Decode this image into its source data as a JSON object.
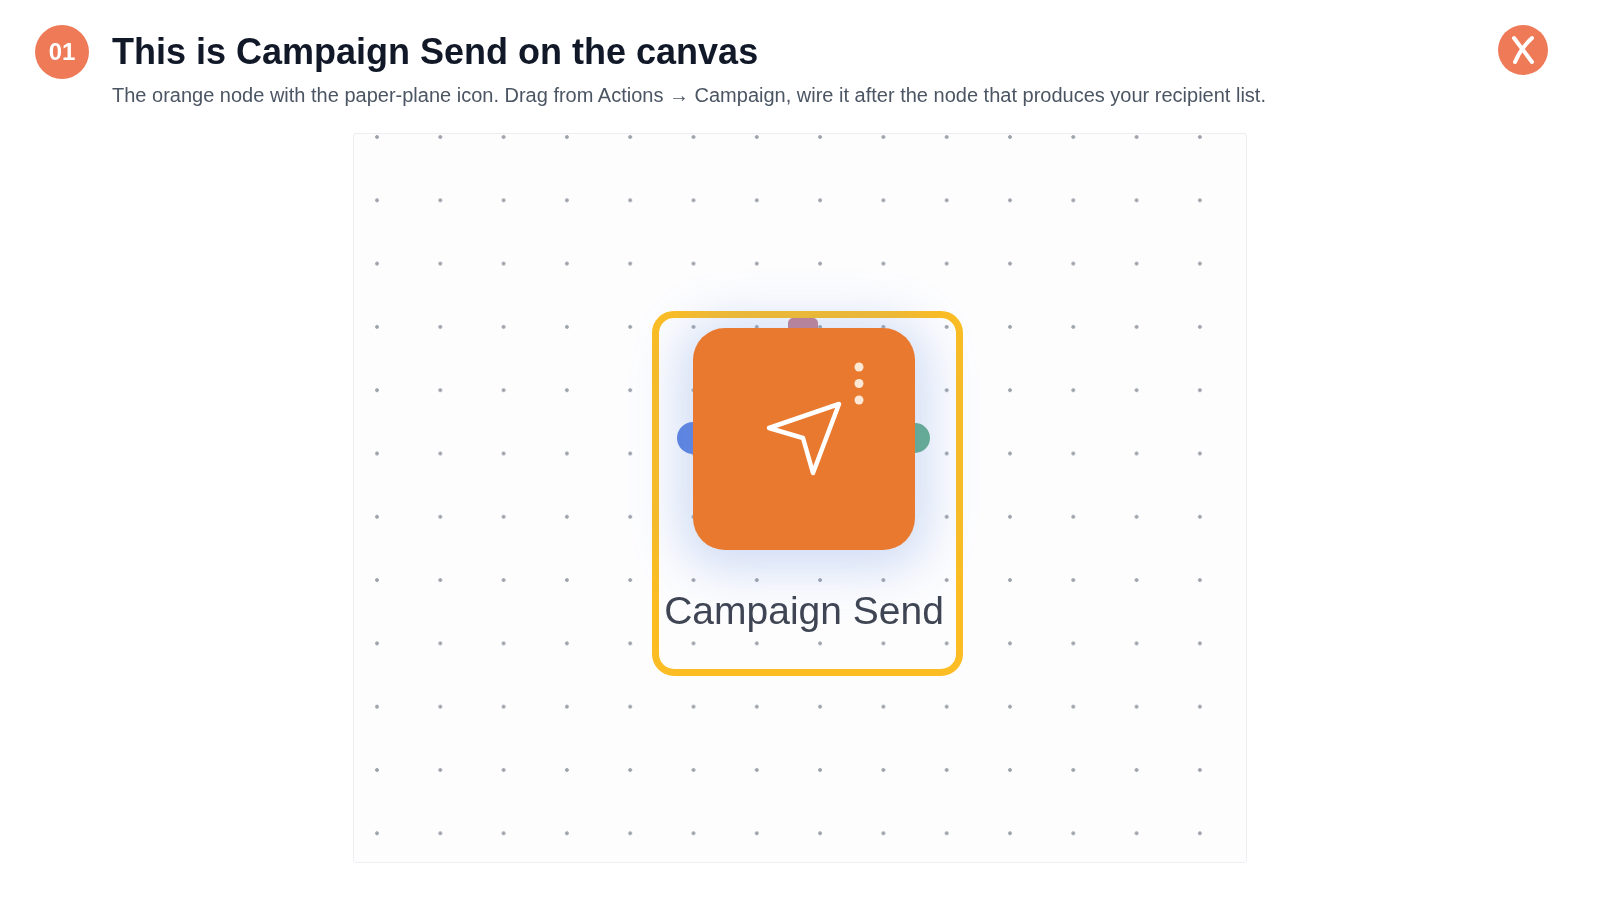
{
  "step": {
    "number": "01",
    "title": "This is Campaign Send on the canvas",
    "description": "The orange node with the paper-plane icon. Drag from Actions → Campaign, wire it after the node that produces your recipient list."
  },
  "canvas": {
    "node": {
      "label": "Campaign Send",
      "highlighted": true,
      "ports": [
        {
          "kind": "left",
          "color": "#5b82e0"
        },
        {
          "kind": "right",
          "color": "#63ae88"
        },
        {
          "kind": "top",
          "color": "#c4808f"
        }
      ]
    }
  }
}
